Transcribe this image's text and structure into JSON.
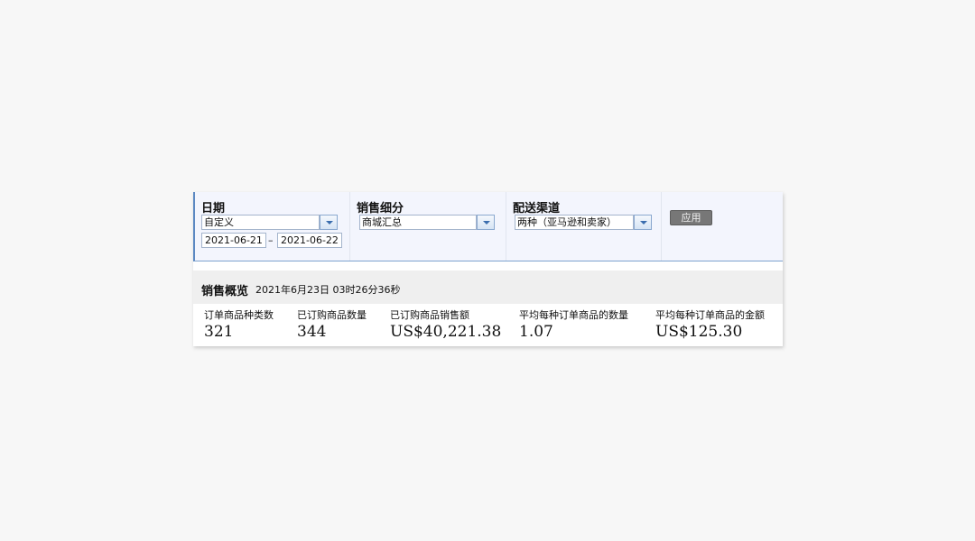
{
  "filters": {
    "date": {
      "label": "日期",
      "range_type": "自定义",
      "start": "2021-06-21",
      "separator": "–",
      "end": "2021-06-22"
    },
    "segment": {
      "label": "销售细分",
      "value": "商城汇总"
    },
    "shipping": {
      "label": "配送渠道",
      "value": "两种（亚马逊和卖家）"
    },
    "apply_label": "应用"
  },
  "overview": {
    "title": "销售概览",
    "timestamp": "2021年6月23日 03时26分36秒",
    "metrics": [
      {
        "label": "订单商品种类数",
        "value": "321"
      },
      {
        "label": "已订购商品数量",
        "value": "344"
      },
      {
        "label": "已订购商品销售额",
        "value": "US$40,221.38"
      },
      {
        "label": "平均每种订单商品的数量",
        "value": "1.07"
      },
      {
        "label": "平均每种订单商品的金额",
        "value": "US$125.30"
      }
    ]
  },
  "icons": {
    "dropdown": "chevron-down-icon"
  }
}
